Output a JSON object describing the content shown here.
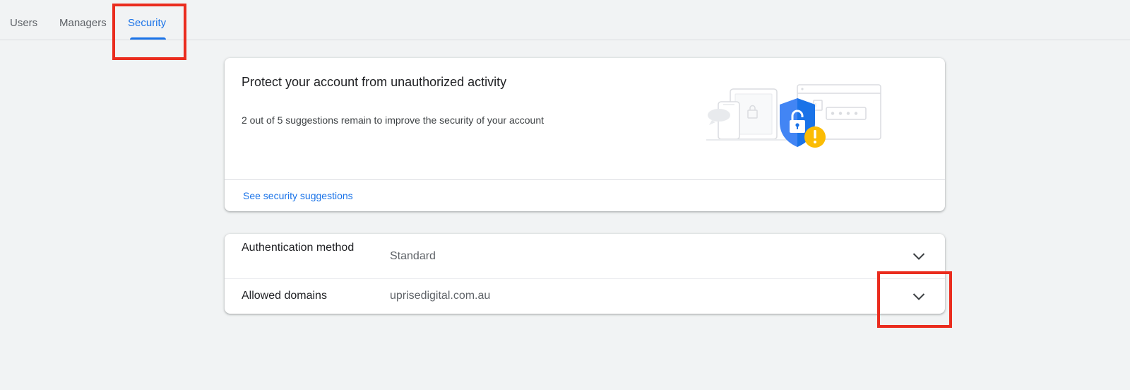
{
  "tabs": {
    "users": "Users",
    "managers": "Managers",
    "security": "Security",
    "active": "security"
  },
  "security_card": {
    "title": "Protect your account from unauthorized activity",
    "subtitle": "2 out of 5 suggestions remain to improve the security of your account",
    "link": "See security suggestions",
    "illustration": "security-shield-illustration"
  },
  "settings": {
    "authentication": {
      "label": "Authentication method",
      "value": "Standard"
    },
    "allowed_domains": {
      "label": "Allowed domains",
      "value": "uprisedigital.com.au"
    }
  },
  "colors": {
    "accent": "#1a73e8",
    "shield": "#4285f4",
    "warning": "#fbbc04",
    "highlight": "#ea2c1e",
    "background": "#f1f3f4"
  }
}
